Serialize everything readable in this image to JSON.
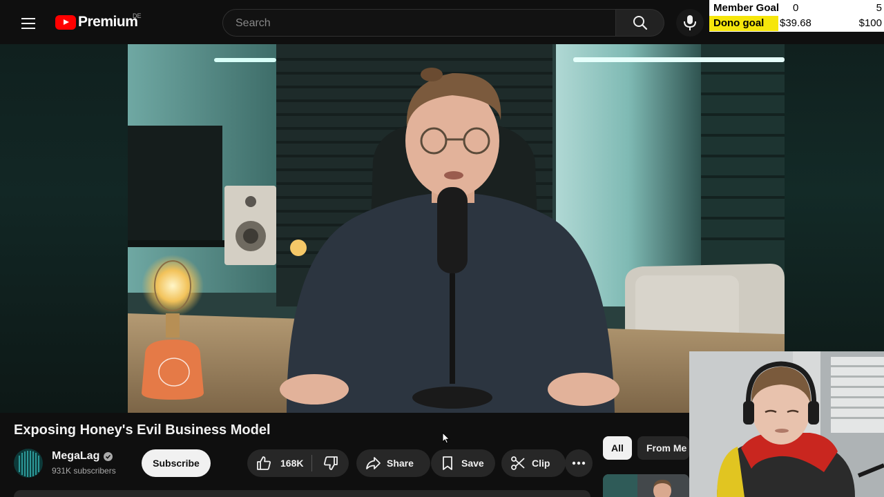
{
  "header": {
    "logo_text": "Premium",
    "logo_region": "DE",
    "search_placeholder": "Search"
  },
  "stream_overlay": {
    "member_goal": {
      "label": "Member Goal",
      "current": "0",
      "target": "5"
    },
    "dono_goal": {
      "label": "Dono goal",
      "current": "$39.68",
      "target": "$100"
    }
  },
  "video": {
    "title": "Exposing Honey's Evil Business Model",
    "channel": {
      "name": "MegaLag",
      "subscribers": "931K subscribers",
      "verified": true
    },
    "actions": {
      "subscribe": "Subscribe",
      "likes": "168K",
      "share": "Share",
      "save": "Save",
      "clip": "Clip"
    }
  },
  "sidebar_chips": [
    "All",
    "From Me"
  ],
  "colors": {
    "background": "#0f0f0f",
    "pill": "#272727",
    "accent_red": "#ff0000",
    "goal_highlight": "#f6e60b"
  }
}
